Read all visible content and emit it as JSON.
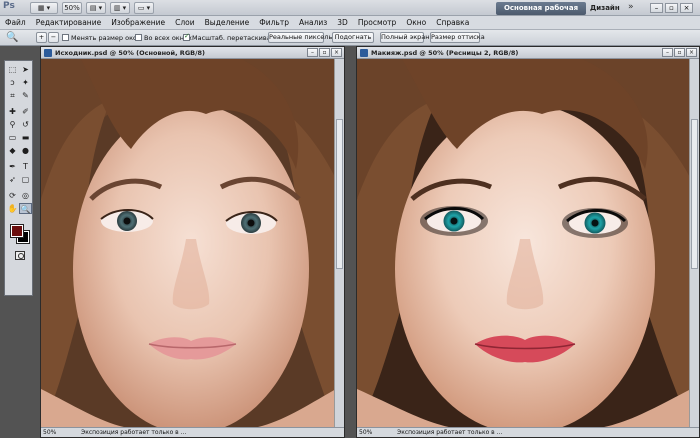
{
  "app": {
    "logo": "Ps",
    "workspace_active": "Основная рабочая среда",
    "workspace_alt": "Дизайн",
    "more": "»",
    "zoom_value": "50%"
  },
  "menu": [
    "Файл",
    "Редактирование",
    "Изображение",
    "Слои",
    "Выделение",
    "Фильтр",
    "Анализ",
    "3D",
    "Просмотр",
    "Окно",
    "Справка"
  ],
  "options": {
    "resize_windows": "Менять размер окон",
    "all_windows": "Во всех окнах",
    "scrubby_zoom": "Масштаб. перетаскиванием",
    "actual_pixels": "Реальные пикселы",
    "fit_screen": "Подогнать",
    "fill_screen": "Полный экран",
    "print_size": "Размер оттиска"
  },
  "docs": [
    {
      "title": "Исходник.psd @ 50% (Основной, RGB/8)",
      "zoom": "50%",
      "status": "Экспозиция работает только в ..."
    },
    {
      "title": "Макияж.psd @ 50% (Ресницы 2, RGB/8)",
      "zoom": "50%",
      "status": "Экспозиция работает только в ..."
    }
  ],
  "colors": {
    "foreground": "#6b0d0d",
    "background": "#000000",
    "workspace_accent": "#4c5a6d"
  }
}
